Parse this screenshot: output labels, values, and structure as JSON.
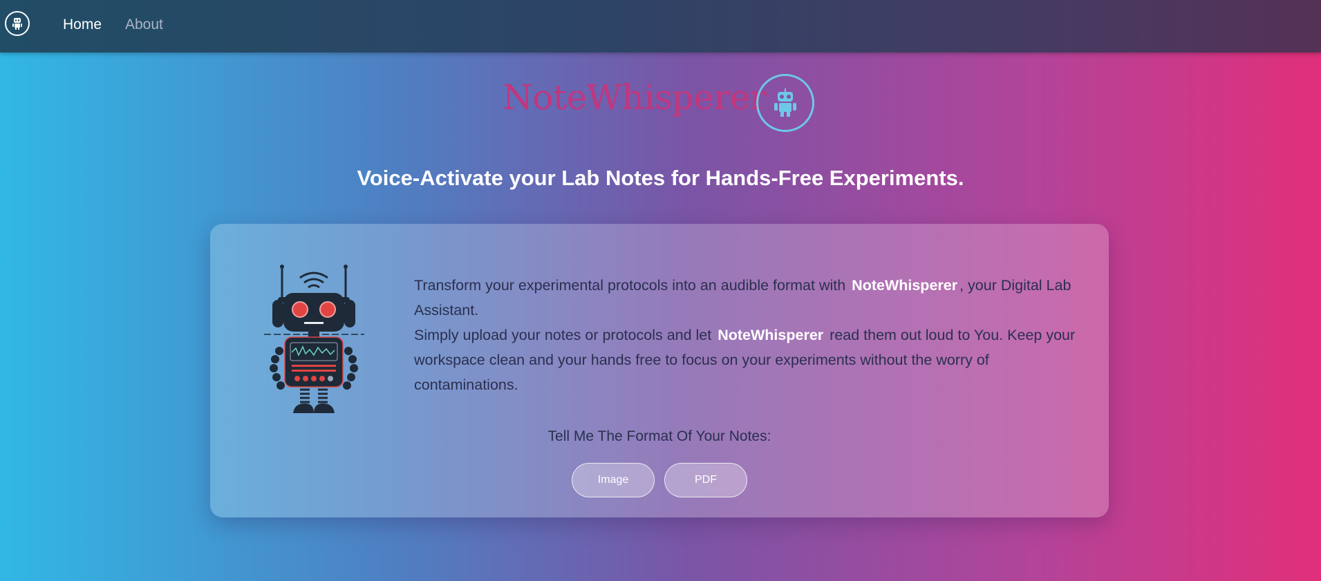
{
  "nav": {
    "logo_icon": "robot-icon",
    "home_label": "Home",
    "about_label": "About"
  },
  "brand": {
    "name": "NoteWhisperer",
    "logo_icon": "robot-icon",
    "name_color": "#c2367e",
    "logo_color": "#6ec8e8"
  },
  "tagline": "Voice-Activate your Lab Notes for Hands-Free Experiments.",
  "card": {
    "illustration_icon": "robot-illustration",
    "intro_1": "Transform your experimental protocols into an audible format with",
    "brand_1": "NoteWhisperer",
    "intro_2": ", your Digital Lab Assistant.",
    "para_1": "Simply upload your notes or protocols and let",
    "brand_2": "NoteWhisperer",
    "para_2": "read them out loud to You. Keep your workspace clean and your hands free to focus on your experiments without the worry of contaminations.",
    "format_prompt": "Tell Me The Format Of Your Notes:",
    "buttons": {
      "image_label": "Image",
      "pdf_label": "PDF"
    }
  }
}
